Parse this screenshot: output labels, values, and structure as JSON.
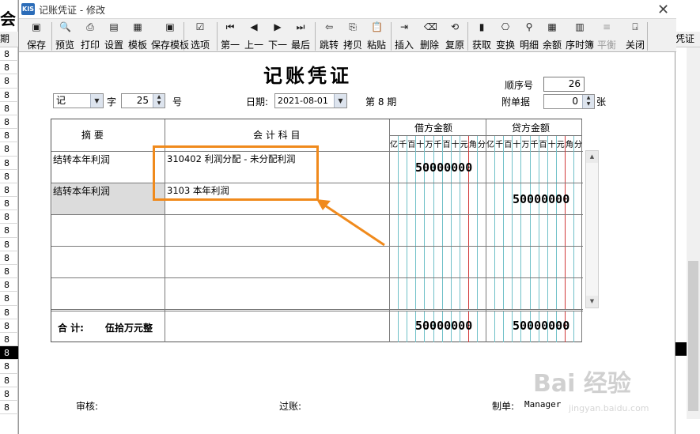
{
  "window": {
    "title": "记账凭证 - 修改",
    "app_icon": "KIS",
    "close_label": "✕"
  },
  "background": {
    "left_title": "会",
    "left_header": "期间",
    "left_rows": [
      "8",
      "8",
      "8",
      "8",
      "8",
      "8",
      "8",
      "8",
      "8",
      "8",
      "8",
      "8",
      "8",
      "8",
      "8",
      "8",
      "8",
      "8",
      "8",
      "8",
      "8",
      "8",
      "8",
      "8",
      "8",
      "8",
      "8"
    ],
    "left_selected_index": 22,
    "right_header": "凭证"
  },
  "toolbar": {
    "buttons": [
      {
        "label": "保存",
        "icon": "save-icon",
        "glyph": "▣",
        "disabled": false
      },
      {
        "label": "预览",
        "icon": "preview-icon",
        "glyph": "🔍",
        "disabled": false
      },
      {
        "label": "打印",
        "icon": "print-icon",
        "glyph": "⎙",
        "disabled": false
      },
      {
        "label": "设置",
        "icon": "settings-icon",
        "glyph": "▤",
        "disabled": false
      },
      {
        "label": "模板",
        "icon": "template-icon",
        "glyph": "▦",
        "disabled": false
      },
      {
        "label": "保存模板",
        "icon": "save-template-icon",
        "glyph": "▣",
        "disabled": false
      },
      {
        "label": "选项",
        "icon": "options-icon",
        "glyph": "☑",
        "disabled": false
      },
      {
        "label": "第一",
        "icon": "first-icon",
        "glyph": "⏮",
        "disabled": false
      },
      {
        "label": "上一",
        "icon": "prev-icon",
        "glyph": "◀",
        "disabled": false
      },
      {
        "label": "下一",
        "icon": "next-icon",
        "glyph": "▶",
        "disabled": false
      },
      {
        "label": "最后",
        "icon": "last-icon",
        "glyph": "⏭",
        "disabled": false
      },
      {
        "label": "跳转",
        "icon": "jump-icon",
        "glyph": "⇦",
        "disabled": false
      },
      {
        "label": "拷贝",
        "icon": "copy-icon",
        "glyph": "⎘",
        "disabled": false
      },
      {
        "label": "粘贴",
        "icon": "paste-icon",
        "glyph": "📋",
        "disabled": false
      },
      {
        "label": "插入",
        "icon": "insert-icon",
        "glyph": "⇥",
        "disabled": false
      },
      {
        "label": "删除",
        "icon": "delete-icon",
        "glyph": "⌫",
        "disabled": false
      },
      {
        "label": "复原",
        "icon": "restore-icon",
        "glyph": "⟲",
        "disabled": false
      },
      {
        "label": "获取",
        "icon": "fetch-icon",
        "glyph": "▮",
        "disabled": false
      },
      {
        "label": "变换",
        "icon": "transform-icon",
        "glyph": "⎔",
        "disabled": false
      },
      {
        "label": "明细",
        "icon": "detail-icon",
        "glyph": "⚲",
        "disabled": false
      },
      {
        "label": "余额",
        "icon": "balance-icon",
        "glyph": "▦",
        "disabled": false
      },
      {
        "label": "序时簿",
        "icon": "journal-icon",
        "glyph": "▥",
        "disabled": false
      },
      {
        "label": "平衡",
        "icon": "balance-check-icon",
        "glyph": "≡",
        "disabled": true
      },
      {
        "label": "关闭",
        "icon": "close-door-icon",
        "glyph": "⍈",
        "disabled": false
      }
    ]
  },
  "voucher": {
    "title": "记账凭证",
    "seq_label": "顺序号",
    "seq_value": "26",
    "type_value": "记",
    "zi_label": "字",
    "number_value": "25",
    "hao_label": "号",
    "date_label": "日期:",
    "date_value": "2021-08-01",
    "period_label": "第 8 期",
    "attach_label": "附单据",
    "attach_value": "0",
    "zhang_label": "张"
  },
  "grid": {
    "headers": {
      "summary": "摘    要",
      "account": "会 计 科 目",
      "debit": "借方金额",
      "credit": "贷方金额",
      "digits": [
        "亿",
        "千",
        "百",
        "十",
        "万",
        "千",
        "百",
        "十",
        "元",
        "角",
        "分"
      ]
    },
    "rows": [
      {
        "summary": "结转本年利润",
        "account": "310402 利润分配 - 未分配利润",
        "debit": "50000000",
        "credit": ""
      },
      {
        "summary": "结转本年利润",
        "account": "3103 本年利润",
        "debit": "",
        "credit": "50000000"
      },
      {
        "summary": "",
        "account": "",
        "debit": "",
        "credit": ""
      },
      {
        "summary": "",
        "account": "",
        "debit": "",
        "credit": ""
      },
      {
        "summary": "",
        "account": "",
        "debit": "",
        "credit": ""
      }
    ],
    "total_label": "合  计:",
    "total_words": "伍拾万元整",
    "total_debit": "50000000",
    "total_credit": "50000000"
  },
  "footer": {
    "audit_label": "审核:",
    "post_label": "过账:",
    "maker_label": "制单:",
    "maker_value": "Manager"
  },
  "watermark": {
    "text": "Bai 经验",
    "sub": "jingyan.baidu.com"
  },
  "colors": {
    "highlight": "#f08a1c",
    "digit_line": "#6fc0c8",
    "yuan_line": "#d23a3a"
  }
}
